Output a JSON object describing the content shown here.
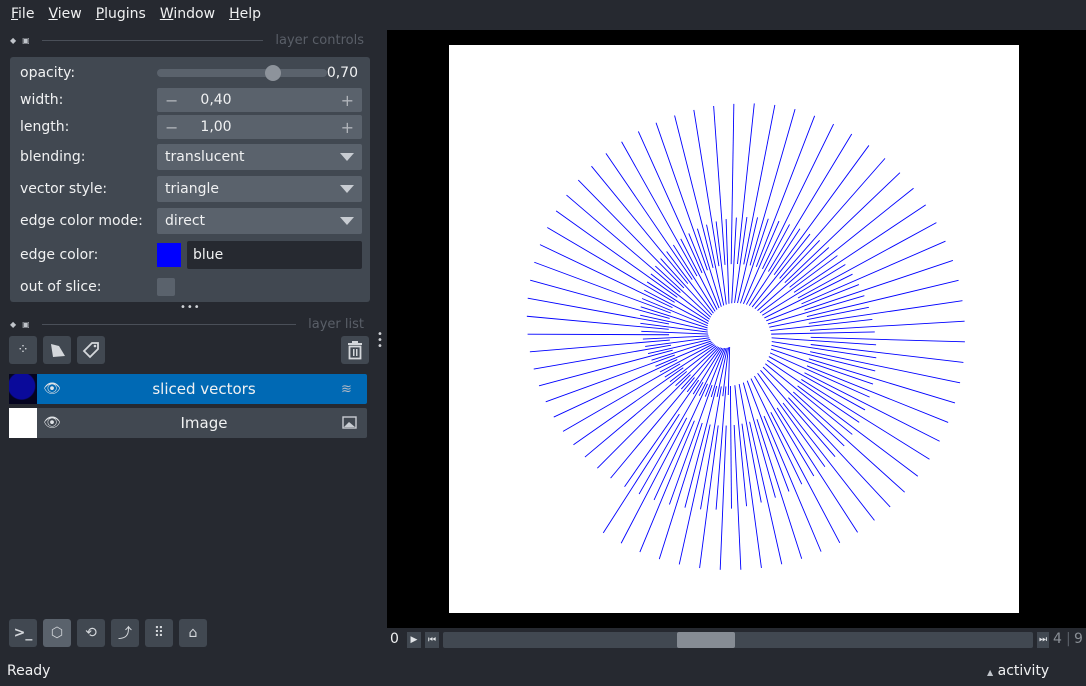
{
  "menu": [
    "File",
    "View",
    "Plugins",
    "Window",
    "Help"
  ],
  "layer_controls": {
    "title": "layer controls",
    "opacity": {
      "label": "opacity:",
      "value": "0,70",
      "fraction": 0.7
    },
    "width": {
      "label": "width:",
      "value": "0,40"
    },
    "length": {
      "label": "length:",
      "value": "1,00"
    },
    "blending": {
      "label": "blending:",
      "value": "translucent"
    },
    "vector_style": {
      "label": "vector style:",
      "value": "triangle"
    },
    "edge_color_mode": {
      "label": "edge color mode:",
      "value": "direct"
    },
    "edge_color": {
      "label": "edge color:",
      "value": "blue",
      "swatch": "#0000ff"
    },
    "out_of_slice": {
      "label": "out of slice:",
      "checked": false
    }
  },
  "layer_list": {
    "title": "layer list",
    "layers": [
      {
        "name": "sliced vectors",
        "selected": true,
        "type_icon": "vectors-icon"
      },
      {
        "name": "Image",
        "selected": false,
        "type_icon": "image-icon"
      }
    ]
  },
  "dims": {
    "current": "0",
    "value": "4",
    "max": "9",
    "position": 4
  },
  "status": {
    "text": "Ready",
    "activity": "activity"
  },
  "colors": {
    "accent": "#0069b4",
    "vectors": "#0000ff",
    "background": "#262930"
  }
}
